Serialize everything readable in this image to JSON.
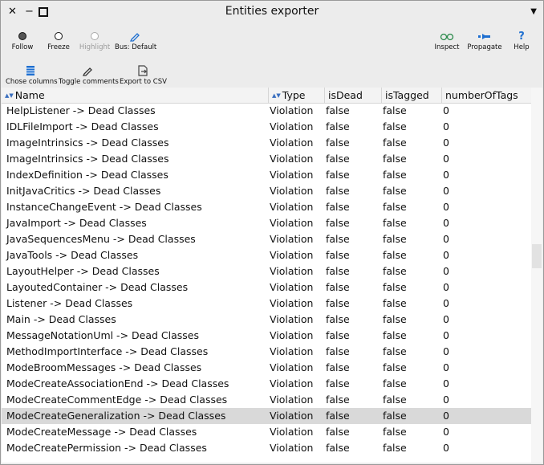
{
  "window": {
    "title": "Entities exporter",
    "close_glyph": "✕",
    "minimize_glyph": "−",
    "maximize_glyph": "□",
    "menu_glyph": "▼"
  },
  "toolbar": {
    "follow": "Follow",
    "freeze": "Freeze",
    "highlight": "Highlight",
    "bus": "Bus: Default",
    "inspect": "Inspect",
    "propagate": "Propagate",
    "help": "Help",
    "chose_columns": "Chose columns",
    "toggle_comments": "Toggle comments",
    "export_csv": "Export to CSV"
  },
  "table": {
    "columns": [
      "Name",
      "Type",
      "isDead",
      "isTagged",
      "numberOfTags"
    ],
    "sort_glyph": "▲▼",
    "selected_row": 19,
    "rows": [
      [
        "HelpListener -> Dead Classes",
        "Violation",
        "false",
        "false",
        "0"
      ],
      [
        "IDLFileImport -> Dead Classes",
        "Violation",
        "false",
        "false",
        "0"
      ],
      [
        "ImageIntrinsics -> Dead Classes",
        "Violation",
        "false",
        "false",
        "0"
      ],
      [
        "ImageIntrinsics -> Dead Classes",
        "Violation",
        "false",
        "false",
        "0"
      ],
      [
        "IndexDefinition -> Dead Classes",
        "Violation",
        "false",
        "false",
        "0"
      ],
      [
        "InitJavaCritics -> Dead Classes",
        "Violation",
        "false",
        "false",
        "0"
      ],
      [
        "InstanceChangeEvent -> Dead Classes",
        "Violation",
        "false",
        "false",
        "0"
      ],
      [
        "JavaImport -> Dead Classes",
        "Violation",
        "false",
        "false",
        "0"
      ],
      [
        "JavaSequencesMenu -> Dead Classes",
        "Violation",
        "false",
        "false",
        "0"
      ],
      [
        "JavaTools -> Dead Classes",
        "Violation",
        "false",
        "false",
        "0"
      ],
      [
        "LayoutHelper -> Dead Classes",
        "Violation",
        "false",
        "false",
        "0"
      ],
      [
        "LayoutedContainer -> Dead Classes",
        "Violation",
        "false",
        "false",
        "0"
      ],
      [
        "Listener -> Dead Classes",
        "Violation",
        "false",
        "false",
        "0"
      ],
      [
        "Main -> Dead Classes",
        "Violation",
        "false",
        "false",
        "0"
      ],
      [
        "MessageNotationUml -> Dead Classes",
        "Violation",
        "false",
        "false",
        "0"
      ],
      [
        "MethodImportInterface -> Dead Classes",
        "Violation",
        "false",
        "false",
        "0"
      ],
      [
        "ModeBroomMessages -> Dead Classes",
        "Violation",
        "false",
        "false",
        "0"
      ],
      [
        "ModeCreateAssociationEnd -> Dead Classes",
        "Violation",
        "false",
        "false",
        "0"
      ],
      [
        "ModeCreateCommentEdge -> Dead Classes",
        "Violation",
        "false",
        "false",
        "0"
      ],
      [
        "ModeCreateGeneralization -> Dead Classes",
        "Violation",
        "false",
        "false",
        "0"
      ],
      [
        "ModeCreateMessage -> Dead Classes",
        "Violation",
        "false",
        "false",
        "0"
      ],
      [
        "ModeCreatePermission -> Dead Classes",
        "Violation",
        "false",
        "false",
        "0"
      ]
    ]
  },
  "colors": {
    "accent": "#1e6fd0",
    "selection": "#d9d9d9"
  }
}
